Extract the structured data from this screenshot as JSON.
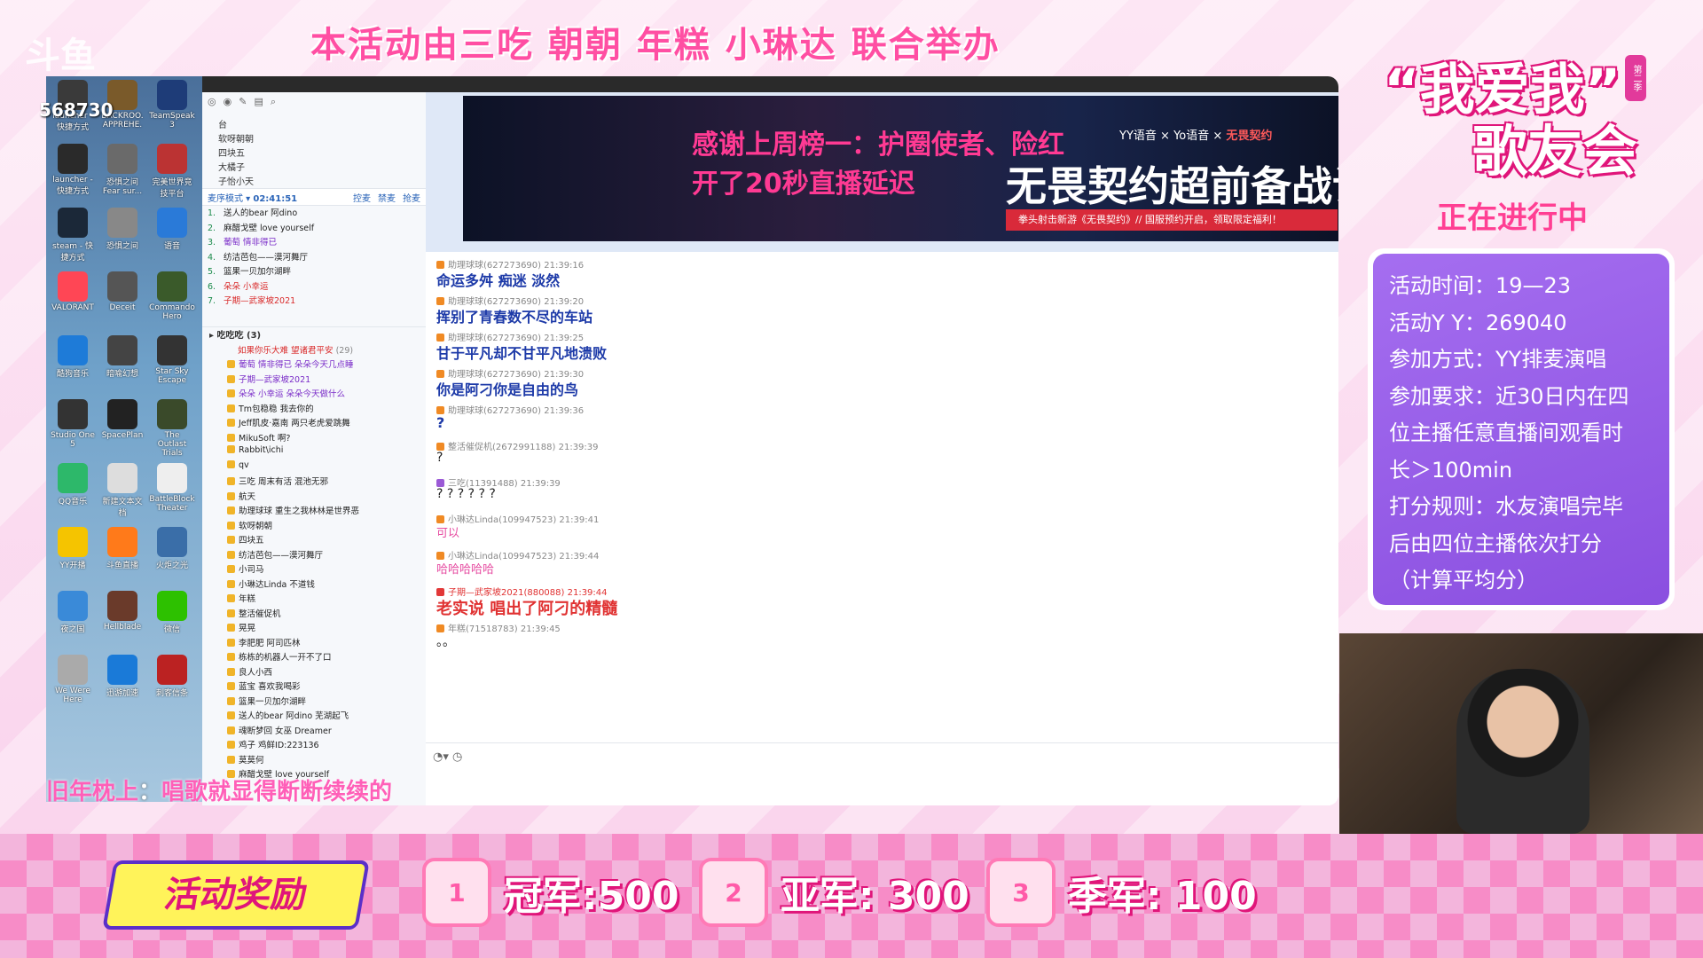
{
  "banner": {
    "title": "本活动由三吃 朝朝 年糕 小琳达 联合举办"
  },
  "overlay": {
    "platform_logo": "斗鱼",
    "room_number": "568730"
  },
  "desktop_icons": [
    {
      "label": "launcher - 快捷方式",
      "color": "#3a3a3a"
    },
    {
      "label": "BACKROO. APPREHE.",
      "color": "#7a5a2a"
    },
    {
      "label": "TeamSpeak 3",
      "color": "#1e3c78"
    },
    {
      "label": "launcher - 快捷方式",
      "color": "#2a2a2a"
    },
    {
      "label": "恐惧之间 Fear sur...",
      "color": "#6a6a6a"
    },
    {
      "label": "完美世界竞技平台",
      "color": "#b33"
    },
    {
      "label": "steam - 快捷方式",
      "color": "#1b2838"
    },
    {
      "label": "恐惧之间",
      "color": "#888"
    },
    {
      "label": "语音",
      "color": "#2a7ad8"
    },
    {
      "label": "VALORANT",
      "color": "#ff4655"
    },
    {
      "label": "Deceit",
      "color": "#555"
    },
    {
      "label": "Commando Hero",
      "color": "#3a5a2a"
    },
    {
      "label": "酷狗音乐",
      "color": "#1e7bd8"
    },
    {
      "label": "暗喻幻想",
      "color": "#444"
    },
    {
      "label": "Star Sky Escape",
      "color": "#333"
    },
    {
      "label": "Studio One 5",
      "color": "#333"
    },
    {
      "label": "SpacePlan",
      "color": "#222"
    },
    {
      "label": "The Outlast Trials",
      "color": "#3a4a2a"
    },
    {
      "label": "QQ音乐",
      "color": "#2db86a"
    },
    {
      "label": "新建文本文档",
      "color": "#ddd"
    },
    {
      "label": "BattleBlock Theater",
      "color": "#eee"
    },
    {
      "label": "YY开播",
      "color": "#f5c400"
    },
    {
      "label": "斗鱼直播",
      "color": "#ff7a1a"
    },
    {
      "label": "火炬之光",
      "color": "#3a6ea8"
    },
    {
      "label": "夜之国",
      "color": "#3a8ad8"
    },
    {
      "label": "Hellblade",
      "color": "#6a3a2a"
    },
    {
      "label": "微信",
      "color": "#2dc100"
    },
    {
      "label": "We Were Here",
      "color": "#aaa"
    },
    {
      "label": "迅游加速",
      "color": "#1a7ad8"
    },
    {
      "label": "刺客信条",
      "color": "#b22"
    }
  ],
  "channel": {
    "tools": [
      "◎",
      "◉",
      "✎",
      "▤",
      "⌕"
    ],
    "rooms": [
      "台",
      "软呀朝朝",
      "四块五",
      "大橘子",
      "子怡小天"
    ],
    "mode": "麦序模式",
    "timer": "02:41:51",
    "actions": [
      "控麦",
      "禁麦",
      "抢麦"
    ],
    "queue": [
      {
        "num": "1.",
        "name": "送人的bear 阿dino"
      },
      {
        "num": "2.",
        "name": "麻醋戈壁 love yourself"
      },
      {
        "num": "3.",
        "name": "葡萄 情非得已"
      },
      {
        "num": "4.",
        "name": "纺洁芭包——漠河舞厅"
      },
      {
        "num": "5.",
        "name": "篮果一贝加尔湖畔"
      },
      {
        "num": "6.",
        "name": "朵朵 小幸运"
      },
      {
        "num": "7.",
        "name": "子期—武家坡2021"
      }
    ],
    "group": {
      "name": "吃吃吃",
      "count": "(3)"
    },
    "notice": "如果你乐大难 望诸君平安",
    "notice_count": "(29)",
    "users": [
      "葡萄 情非得已 朵朵今天几点睡",
      "子期—武家坡2021",
      "朵朵 小幸运 朵朵今天做什么",
      "Tm包稳稳 我去你的",
      "Jeff肌皮·嘉南 两只老虎爱跳舞",
      "MikuSoft 啊?",
      "Rabbit\\ichi",
      "qv",
      "三吃 周末有活 混池无邪",
      "航天",
      "助理球球 重生之我林林是世界恶",
      "软呀朝朝",
      "四块五",
      "纺洁芭包——漠河舞厅",
      "小司马",
      "小琳达Linda 不道钱",
      "年糕",
      "整活催促机",
      "晃晃",
      "李肥肥 阿司匹林",
      "栋栋的机器人一开不了口",
      "良人小西",
      "蓝宝 喜欢我喝彩",
      "篮果一贝加尔湖畔",
      "送人的bear 阿dino 芜湖起飞",
      "魂断梦回 女巫 Dreamer",
      "鸡子 鸡鲜ID:223136",
      "莫莫何",
      "麻醋戈壁 love yourself"
    ]
  },
  "ad": {
    "thanks_line1": "感谢上周榜一：护圈使者、险红",
    "thanks_line2": "开了20秒直播延迟",
    "brands": [
      "YY语音",
      "Yo语音",
      "无畏契约"
    ],
    "title": "无畏契约超前备战计划",
    "strip": "拳头射击新游《无畏契约》// 国服预约开启，领取限定福利！"
  },
  "chat": [
    {
      "head": "助理球球(627273690)  21:39:16",
      "text": "命运多舛 痴迷 淡然",
      "style": "",
      "rank": ""
    },
    {
      "head": "助理球球(627273690)  21:39:20",
      "text": "挥别了青春数不尽的车站",
      "style": "",
      "rank": ""
    },
    {
      "head": "助理球球(627273690)  21:39:25",
      "text": "甘于平凡却不甘平凡地溃败",
      "style": "",
      "rank": ""
    },
    {
      "head": "助理球球(627273690)  21:39:30",
      "text": "你是阿刁你是自由的鸟",
      "style": "",
      "rank": ""
    },
    {
      "head": "助理球球(627273690)  21:39:36",
      "text": "?",
      "style": "",
      "rank": ""
    },
    {
      "head": "整活催促机(2672991188)  21:39:39",
      "text": "?",
      "style": "plain",
      "rank": ""
    },
    {
      "head": "三吃(11391488)  21:39:39",
      "text": "? ? ? ? ? ?",
      "style": "plain",
      "rank": "p"
    },
    {
      "head": "小琳达Linda(109947523)  21:39:41",
      "text": "可以",
      "style": "pink",
      "rank": ""
    },
    {
      "head": "小琳达Linda(109947523)  21:39:44",
      "text": "哈哈哈哈哈",
      "style": "pink",
      "rank": ""
    },
    {
      "head": "子期—武家坡2021(880088)  21:39:44",
      "text": "老实说 唱出了阿刁的精髓",
      "style": "big",
      "rank": "r"
    },
    {
      "head": "年糕(71518783)  21:39:45",
      "text": "。。",
      "style": "plain",
      "rank": ""
    }
  ],
  "input": {
    "tools": "◔▾  ◷"
  },
  "lyrics": {
    "sung": "旧年枕上",
    "sep": "：",
    "unsung": "唱歌就显得断断续续的"
  },
  "event": {
    "logo_line1": "“我爱我”",
    "logo_line2": "歌友会",
    "season": "第二季",
    "status": "正在进行中",
    "info": [
      "活动时间：19—23",
      "活动Y Y：269040",
      "参加方式：YY排麦演唱",
      "参加要求：近30日内在四",
      "位主播任意直播间观看时",
      "长＞100min",
      "打分规则：水友演唱完毕",
      "后由四位主播依次打分",
      "（计算平均分）"
    ]
  },
  "rewards": {
    "tag": "活动奖励",
    "prizes": [
      {
        "medal": "1",
        "label": "冠军:500"
      },
      {
        "medal": "2",
        "label": "亚军: 300"
      },
      {
        "medal": "3",
        "label": "季军: 100"
      }
    ]
  },
  "colors": {
    "accent_pink": "#ff4fa3",
    "card_purple": "#9b5ce6",
    "chat_blue": "#1d3aa8"
  }
}
